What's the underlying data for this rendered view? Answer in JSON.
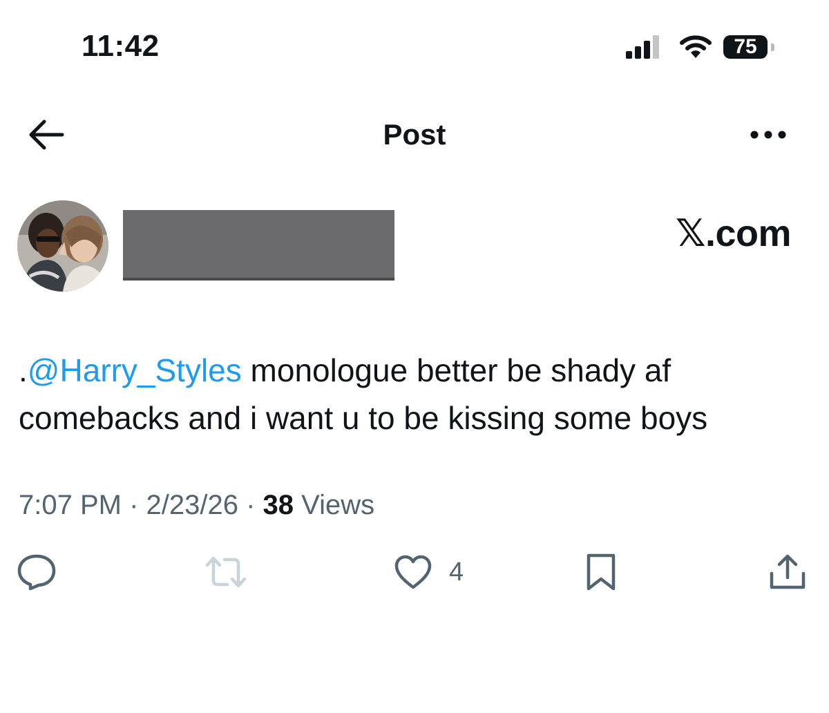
{
  "status_bar": {
    "time": "11:42",
    "battery_level": "75",
    "icons": [
      "signal-bars-icon",
      "wifi-icon",
      "battery-icon"
    ]
  },
  "header": {
    "title": "Post",
    "back_icon": "arrow-left-icon",
    "more_icon": "more-horizontal-icon"
  },
  "author": {
    "avatar": "avatar-photo",
    "name_redacted": true
  },
  "watermark": "𝕏.com",
  "tweet": {
    "prefix": ".",
    "mention": "@Harry_Styles",
    "text": " monologue better be shady af comebacks and i want u to be kissing some boys"
  },
  "meta": {
    "time": "7:07 PM",
    "separator": " · ",
    "date": "2/23/26",
    "views_count": "38",
    "views_label": " Views"
  },
  "actions": {
    "like_count": "4",
    "icons": [
      "reply-icon",
      "retweet-icon",
      "heart-icon",
      "bookmark-icon",
      "share-icon"
    ]
  },
  "colors": {
    "text": "#0f1419",
    "secondary": "#536471",
    "link": "#1d9bf0",
    "retweet_disabled": "#c8d3dc",
    "redaction": "#6b6b6d"
  }
}
